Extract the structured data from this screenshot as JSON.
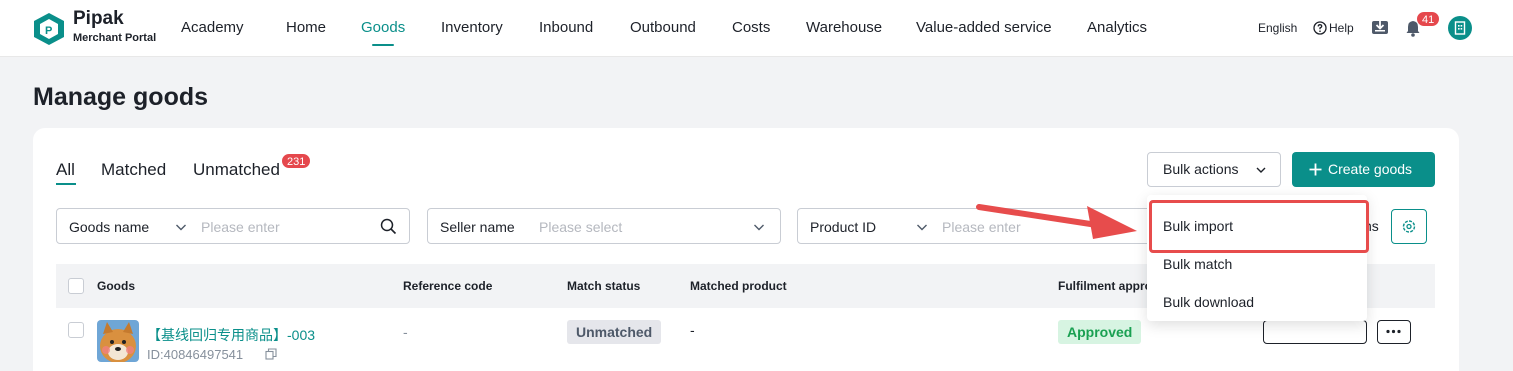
{
  "brand": {
    "name": "Pipak",
    "subtitle": "Merchant Portal"
  },
  "nav": {
    "items": [
      {
        "label": "Academy"
      },
      {
        "label": "Home"
      },
      {
        "label": "Goods",
        "active": true
      },
      {
        "label": "Inventory"
      },
      {
        "label": "Inbound"
      },
      {
        "label": "Outbound"
      },
      {
        "label": "Costs"
      },
      {
        "label": "Warehouse"
      },
      {
        "label": "Value-added service"
      },
      {
        "label": "Analytics"
      }
    ],
    "language": "English",
    "help": "Help",
    "notification_count": "41",
    "accent_color": "#0a8f8a"
  },
  "page": {
    "title": "Manage goods"
  },
  "tabs": [
    {
      "label": "All",
      "active": true
    },
    {
      "label": "Matched"
    },
    {
      "label": "Unmatched",
      "badge": "231"
    }
  ],
  "actions": {
    "bulk_label": "Bulk actions",
    "create_label": "Create goods"
  },
  "filters": {
    "goods_name": {
      "label": "Goods name",
      "placeholder": "Please enter"
    },
    "seller_name": {
      "label": "Seller name",
      "placeholder": "Please select"
    },
    "product_id": {
      "label": "Product ID",
      "placeholder": "Please enter"
    },
    "columns_tail": "ns"
  },
  "dropdown": {
    "items": [
      {
        "label": "Bulk import",
        "highlighted": true
      },
      {
        "label": "Bulk match"
      },
      {
        "label": "Bulk download"
      }
    ]
  },
  "table": {
    "headers": [
      "Goods",
      "Reference code",
      "Match status",
      "Matched product",
      "Fulfilment appro"
    ],
    "rows": [
      {
        "name": "【基线回归专用商品】-003",
        "id": "ID:40846497541",
        "reference_code": "-",
        "match_status": "Unmatched",
        "matched_product": "-",
        "fulfilment": "Approved"
      }
    ]
  }
}
